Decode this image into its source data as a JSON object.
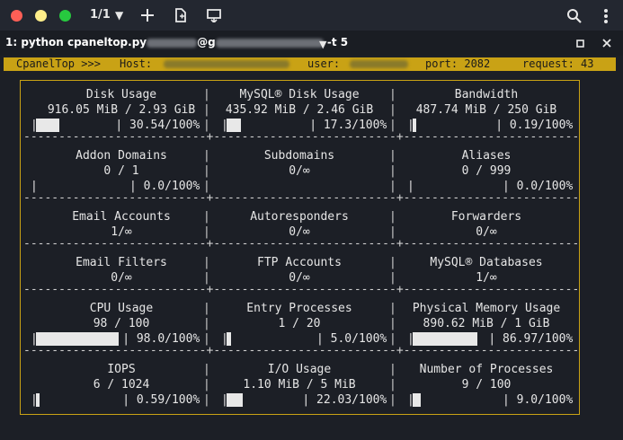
{
  "window": {
    "tab_counter": "1/1",
    "tab_title": "1: python cpaneltop.py",
    "tab_title_mid": "@g",
    "tab_title_end": "-t 5"
  },
  "status": {
    "brand": "CpanelTop >>>",
    "host_label": "Host:",
    "user_label": "user:",
    "port": "port: 2082",
    "request": "request: 43"
  },
  "colors": {
    "accent": "#c9a215",
    "background": "#1c1f26"
  },
  "icons": [
    "chevron-down-icon",
    "plus-icon",
    "new-tab-icon",
    "split-icon",
    "search-icon",
    "kebab-menu-icon",
    "maximize-icon",
    "close-icon"
  ],
  "cells": [
    {
      "title": "Disk Usage",
      "value": "916.05 MiB / 2.93 GiB",
      "bar": true,
      "percent_text": "30.54/100%",
      "fill": 0.3054
    },
    {
      "title": "MySQL® Disk Usage",
      "value": "435.92 MiB / 2.46 GiB",
      "bar": true,
      "percent_text": "17.3/100%",
      "fill": 0.173
    },
    {
      "title": "Bandwidth",
      "value": "487.74 MiB / 250 GiB",
      "bar": true,
      "percent_text": "0.19/100%",
      "fill": 0.0019
    },
    {
      "title": "Addon Domains",
      "value": "0 / 1",
      "bar": true,
      "percent_text": "0.0/100%",
      "fill": 0
    },
    {
      "title": "Subdomains",
      "value": "0/∞",
      "bar": false
    },
    {
      "title": "Aliases",
      "value": "0 / 999",
      "bar": true,
      "percent_text": "0.0/100%",
      "fill": 0
    },
    {
      "title": "Email Accounts",
      "value": "1/∞",
      "bar": false
    },
    {
      "title": "Autoresponders",
      "value": "0/∞",
      "bar": false
    },
    {
      "title": "Forwarders",
      "value": "0/∞",
      "bar": false
    },
    {
      "title": "Email Filters",
      "value": "0/∞",
      "bar": false
    },
    {
      "title": "FTP Accounts",
      "value": "0/∞",
      "bar": false
    },
    {
      "title": "MySQL® Databases",
      "value": "1/∞",
      "bar": false
    },
    {
      "title": "CPU Usage",
      "value": "98 / 100",
      "bar": true,
      "percent_text": "98.0/100%",
      "fill": 0.98
    },
    {
      "title": "Entry Processes",
      "value": "1 / 20",
      "bar": true,
      "percent_text": "5.0/100%",
      "fill": 0.05
    },
    {
      "title": "Physical Memory Usage",
      "value": "890.62 MiB / 1 GiB",
      "bar": true,
      "percent_text": "86.97/100%",
      "fill": 0.8697
    },
    {
      "title": "IOPS",
      "value": "6 / 1024",
      "bar": true,
      "percent_text": "0.59/100%",
      "fill": 0.0059
    },
    {
      "title": "I/O Usage",
      "value": "1.10 MiB / 5 MiB",
      "bar": true,
      "percent_text": "22.03/100%",
      "fill": 0.2203
    },
    {
      "title": "Number of Processes",
      "value": "9 / 100",
      "bar": true,
      "percent_text": "9.0/100%",
      "fill": 0.09
    }
  ]
}
